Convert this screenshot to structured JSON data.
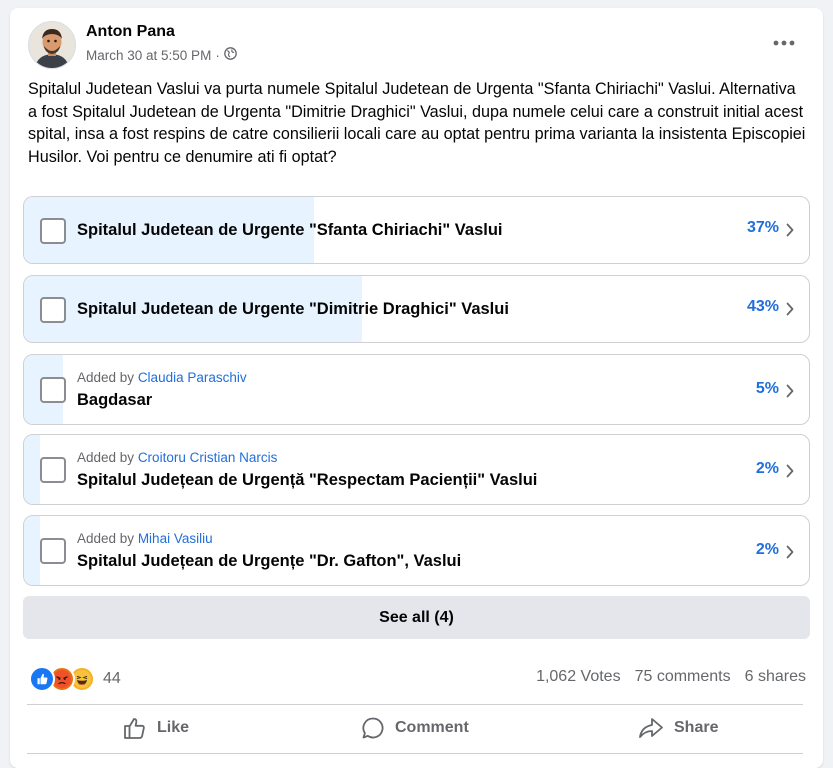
{
  "post": {
    "author": "Anton Pana",
    "timestamp": "March 30 at 5:50 PM",
    "separator": "·",
    "audience_icon": "globe-icon",
    "more_icon": "more-dots-icon",
    "text": "Spitalul Judetean Vaslui va purta numele Spitalul Judetean de Urgenta \"Sfanta Chiriachi\" Vaslui. Alternativa a fost Spitalul Judetean de Urgenta \"Dimitrie Draghici\" Vaslui, dupa numele celui care a construit initial acest spital, insa a fost respins de catre consilierii locali care au optat pentru prima varianta la insistenta Episcopiei Husilor. Voi pentru ce denumire ati fi optat?"
  },
  "poll": {
    "options": [
      {
        "label": "Spitalul Judetean de Urgente \"Sfanta Chiriachi\" Vaslui",
        "percent_text": "37%",
        "percent": 37,
        "added_by_prefix": "",
        "added_by_name": ""
      },
      {
        "label": "Spitalul Judetean de Urgente \"Dimitrie Draghici\" Vaslui",
        "percent_text": "43%",
        "percent": 43,
        "added_by_prefix": "",
        "added_by_name": ""
      },
      {
        "label": "Bagdasar",
        "percent_text": "5%",
        "percent": 5,
        "added_by_prefix": "Added by",
        "added_by_name": "Claudia Paraschiv"
      },
      {
        "label": "Spitalul Județean de Urgență \"Respectam Pacienții\" Vaslui",
        "percent_text": "2%",
        "percent": 2,
        "added_by_prefix": "Added by",
        "added_by_name": "Croitoru Cristian Narcis"
      },
      {
        "label": "Spitalul Județean de Urgențe \"Dr. Gafton\", Vaslui",
        "percent_text": "2%",
        "percent": 2,
        "added_by_prefix": "Added by",
        "added_by_name": "Mihai Vasiliu"
      }
    ],
    "see_all_label": "See all (4)"
  },
  "engagement": {
    "reaction_icons": [
      "like-reaction-icon",
      "angry-reaction-icon",
      "haha-reaction-icon"
    ],
    "reaction_count": "44",
    "votes": "1,062 Votes",
    "comments": "75 comments",
    "shares": "6 shares"
  },
  "actions": {
    "like": "Like",
    "comment": "Comment",
    "share": "Share"
  },
  "colors": {
    "accent": "#216fdb",
    "poll_fill": "#e7f3ff",
    "secondary_text": "#65676b"
  }
}
